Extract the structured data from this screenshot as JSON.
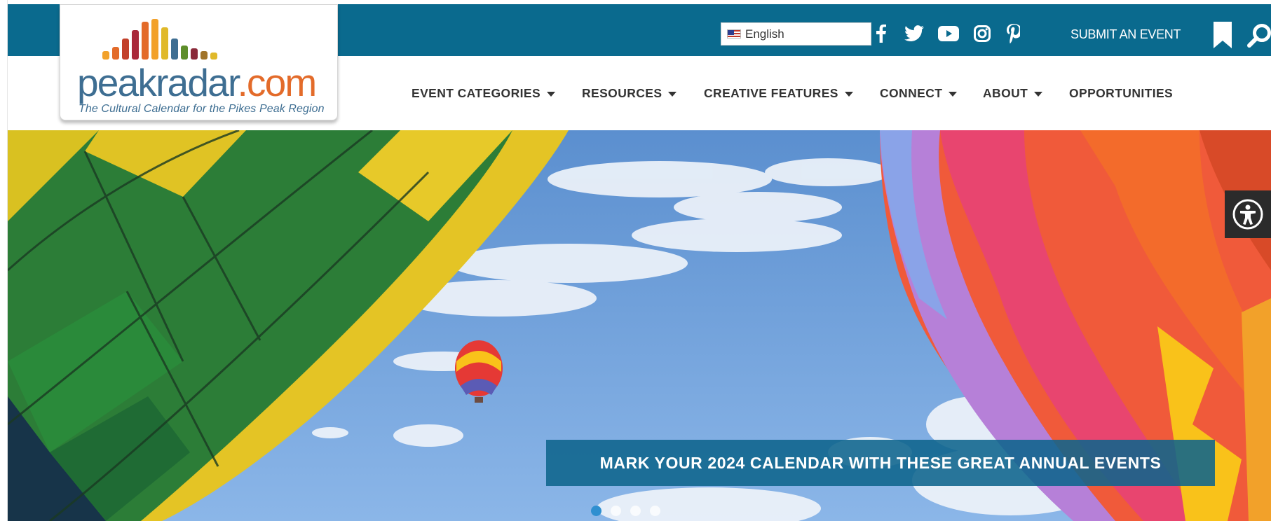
{
  "language": {
    "selected": "English"
  },
  "social_icons": [
    "facebook-icon",
    "twitter-icon",
    "youtube-icon",
    "instagram-icon",
    "pinterest-icon"
  ],
  "top_links": {
    "submit_event": "SUBMIT AN EVENT"
  },
  "logo": {
    "wordmark_main": "peakradar",
    "wordmark_suffix": ".com",
    "tagline": "The Cultural Calendar for the Pikes Peak Region"
  },
  "nav": {
    "items": [
      {
        "label": "EVENT CATEGORIES",
        "dropdown": true
      },
      {
        "label": "RESOURCES",
        "dropdown": true
      },
      {
        "label": "CREATIVE FEATURES",
        "dropdown": true
      },
      {
        "label": "CONNECT",
        "dropdown": true
      },
      {
        "label": "ABOUT",
        "dropdown": true
      },
      {
        "label": "OPPORTUNITIES",
        "dropdown": false
      }
    ]
  },
  "hero": {
    "caption": "MARK YOUR 2024 CALENDAR WITH THESE GREAT ANNUAL EVENTS",
    "slides_count": 4,
    "active_slide": 1
  },
  "colors": {
    "topbar": "#0a6a8e",
    "caption_bg": "#0e648c",
    "logo_blue": "#3e6e92",
    "logo_orange": "#e36b2a"
  }
}
